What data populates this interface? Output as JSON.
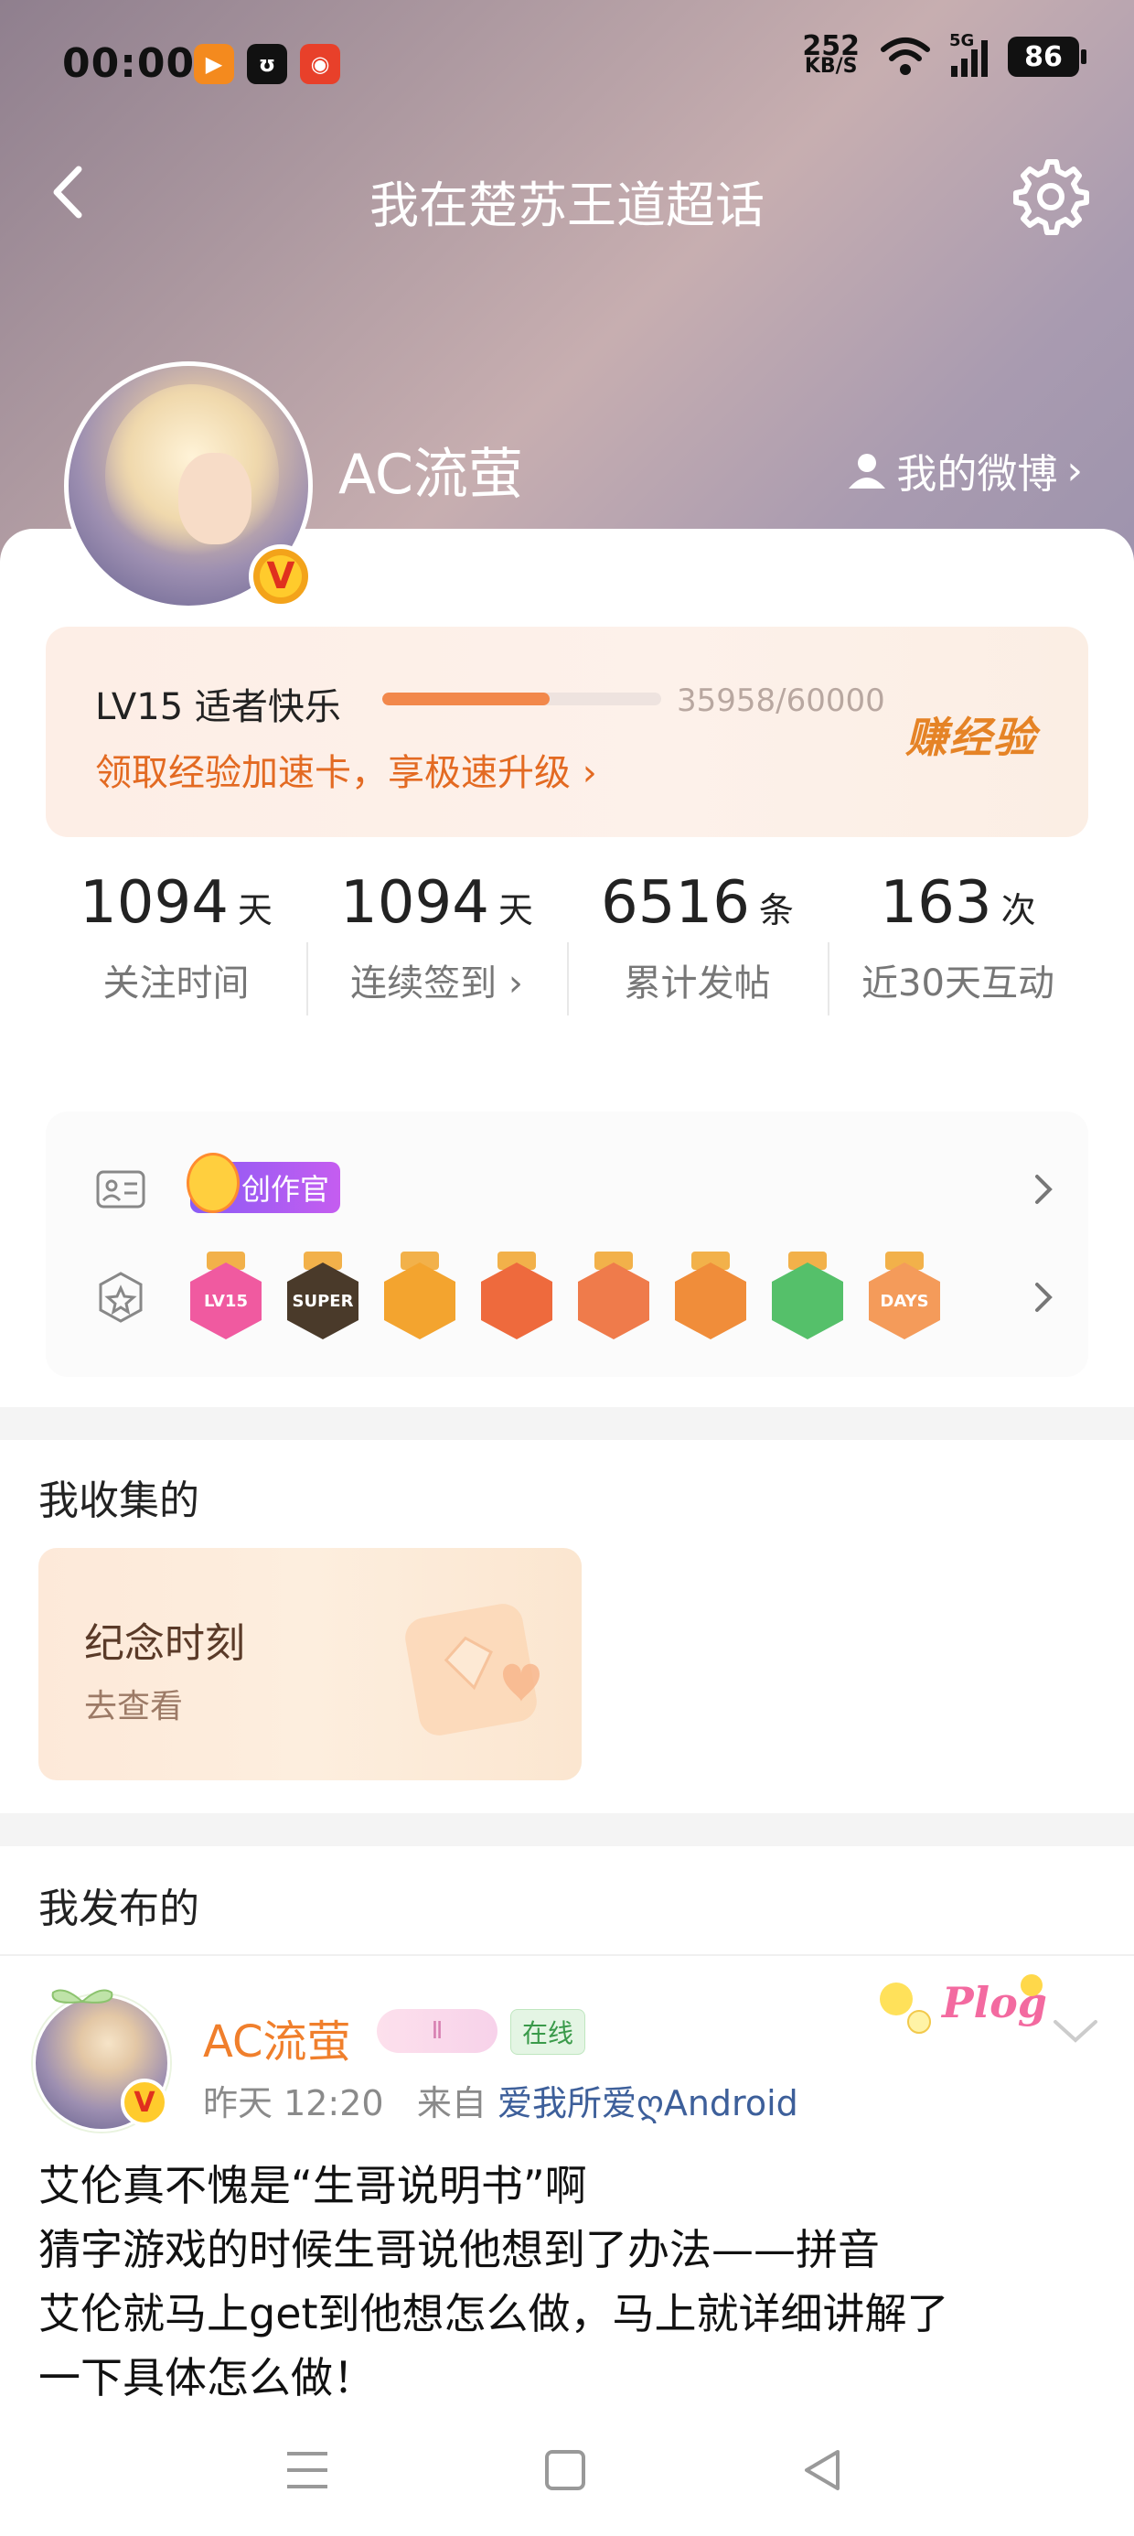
{
  "status": {
    "time": "00:00",
    "net_speed_value": "252",
    "net_speed_unit": "KB/S",
    "network": "5G",
    "battery": "86"
  },
  "nav": {
    "title": "我在楚苏王道超话"
  },
  "profile": {
    "username": "AC流萤",
    "my_weibo": "我的微博",
    "verified_mark": "V"
  },
  "level": {
    "name": "LV15 适者快乐",
    "progress_text": "35958/60000",
    "progress_fraction": 0.5993,
    "link": "领取经验加速卡，享极速升级",
    "earn": "赚经验",
    "accent": "#f2884b"
  },
  "stats": [
    {
      "num": "1094",
      "unit": "天",
      "label": "关注时间"
    },
    {
      "num": "1094",
      "unit": "天",
      "label": "连续签到 ›"
    },
    {
      "num": "6516",
      "unit": "条",
      "label": "累计发帖"
    },
    {
      "num": "163",
      "unit": "次",
      "label": "近30天互动"
    }
  ],
  "badges": {
    "creator_tag": "创作官",
    "medals": [
      {
        "icon": "lv15-medal",
        "text": "LV15",
        "color": "#f05aa0"
      },
      {
        "icon": "super-medal",
        "text": "SUPER",
        "color": "#4a3a2a"
      },
      {
        "icon": "crown-medal",
        "text": "",
        "color": "#f3a42f"
      },
      {
        "icon": "cat-medal-1",
        "text": "",
        "color": "#ee6a3d"
      },
      {
        "icon": "cat-medal-2",
        "text": "",
        "color": "#ef7b4b"
      },
      {
        "icon": "cat-medal-3",
        "text": "",
        "color": "#f08d3a"
      },
      {
        "icon": "hand-medal",
        "text": "",
        "color": "#55c06a"
      },
      {
        "icon": "100-days-medal",
        "text": "DAYS",
        "color": "#f49b5a"
      }
    ]
  },
  "collected": {
    "title": "我收集的",
    "card_title": "纪念时刻",
    "card_sub": "去查看"
  },
  "published": {
    "title": "我发布的",
    "post": {
      "author": "AC流萤",
      "level_tag": "Ⅱ",
      "online": "在线",
      "time": "昨天 12:20",
      "from_label": "来自",
      "source": "爱我所爱ღAndroid",
      "lines": [
        "艾伦真不愧是“生哥说明书”啊",
        "猜字游戏的时候生哥说他想到了办法——拼音",
        "艾伦就马上get到他想怎么做，马上就详细讲解了",
        "一下具体怎么做！"
      ]
    }
  }
}
